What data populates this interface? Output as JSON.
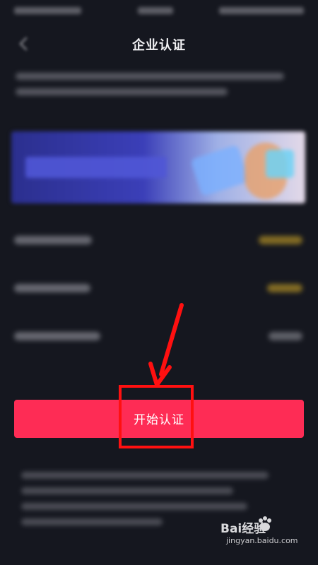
{
  "header": {
    "title": "企业认证",
    "back_icon": "chevron-left-icon"
  },
  "action": {
    "start_label": "开始认证"
  },
  "watermark": {
    "brand": "Bai经验",
    "url": "jingyan.baidu.com"
  },
  "colors": {
    "background": "#15171f",
    "primary_button": "#fe2c55",
    "annotation": "#ff1010",
    "badge_gold": "#c9a227",
    "banner_blue": "#3b3fb8"
  }
}
